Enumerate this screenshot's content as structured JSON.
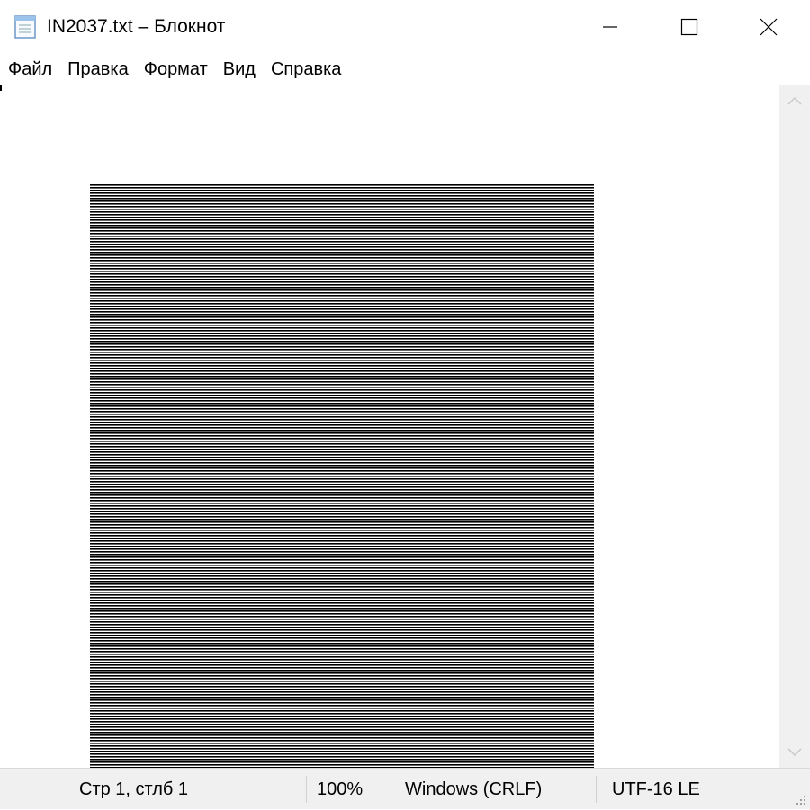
{
  "window": {
    "title": "IN2037.txt – Блокнот"
  },
  "menu": {
    "items": [
      "Файл",
      "Правка",
      "Формат",
      "Вид",
      "Справка"
    ]
  },
  "status": {
    "position": "Стр 1, стлб 1",
    "zoom": "100%",
    "line_endings": "Windows (CRLF)",
    "encoding": "UTF-16 LE"
  },
  "icons": {
    "app": "notepad-icon",
    "minimize": "minimize-icon",
    "maximize": "maximize-icon",
    "close": "close-icon",
    "scroll_up": "chevron-up-icon",
    "scroll_down": "chevron-down-icon"
  },
  "colors": {
    "sky_blue": "#a9b9cf",
    "splash_gray": "#dcdcdc",
    "skin": "#d3b592",
    "sweater": "#f5f2da",
    "brown": "#7b5641",
    "pants": "#c9a98a"
  }
}
